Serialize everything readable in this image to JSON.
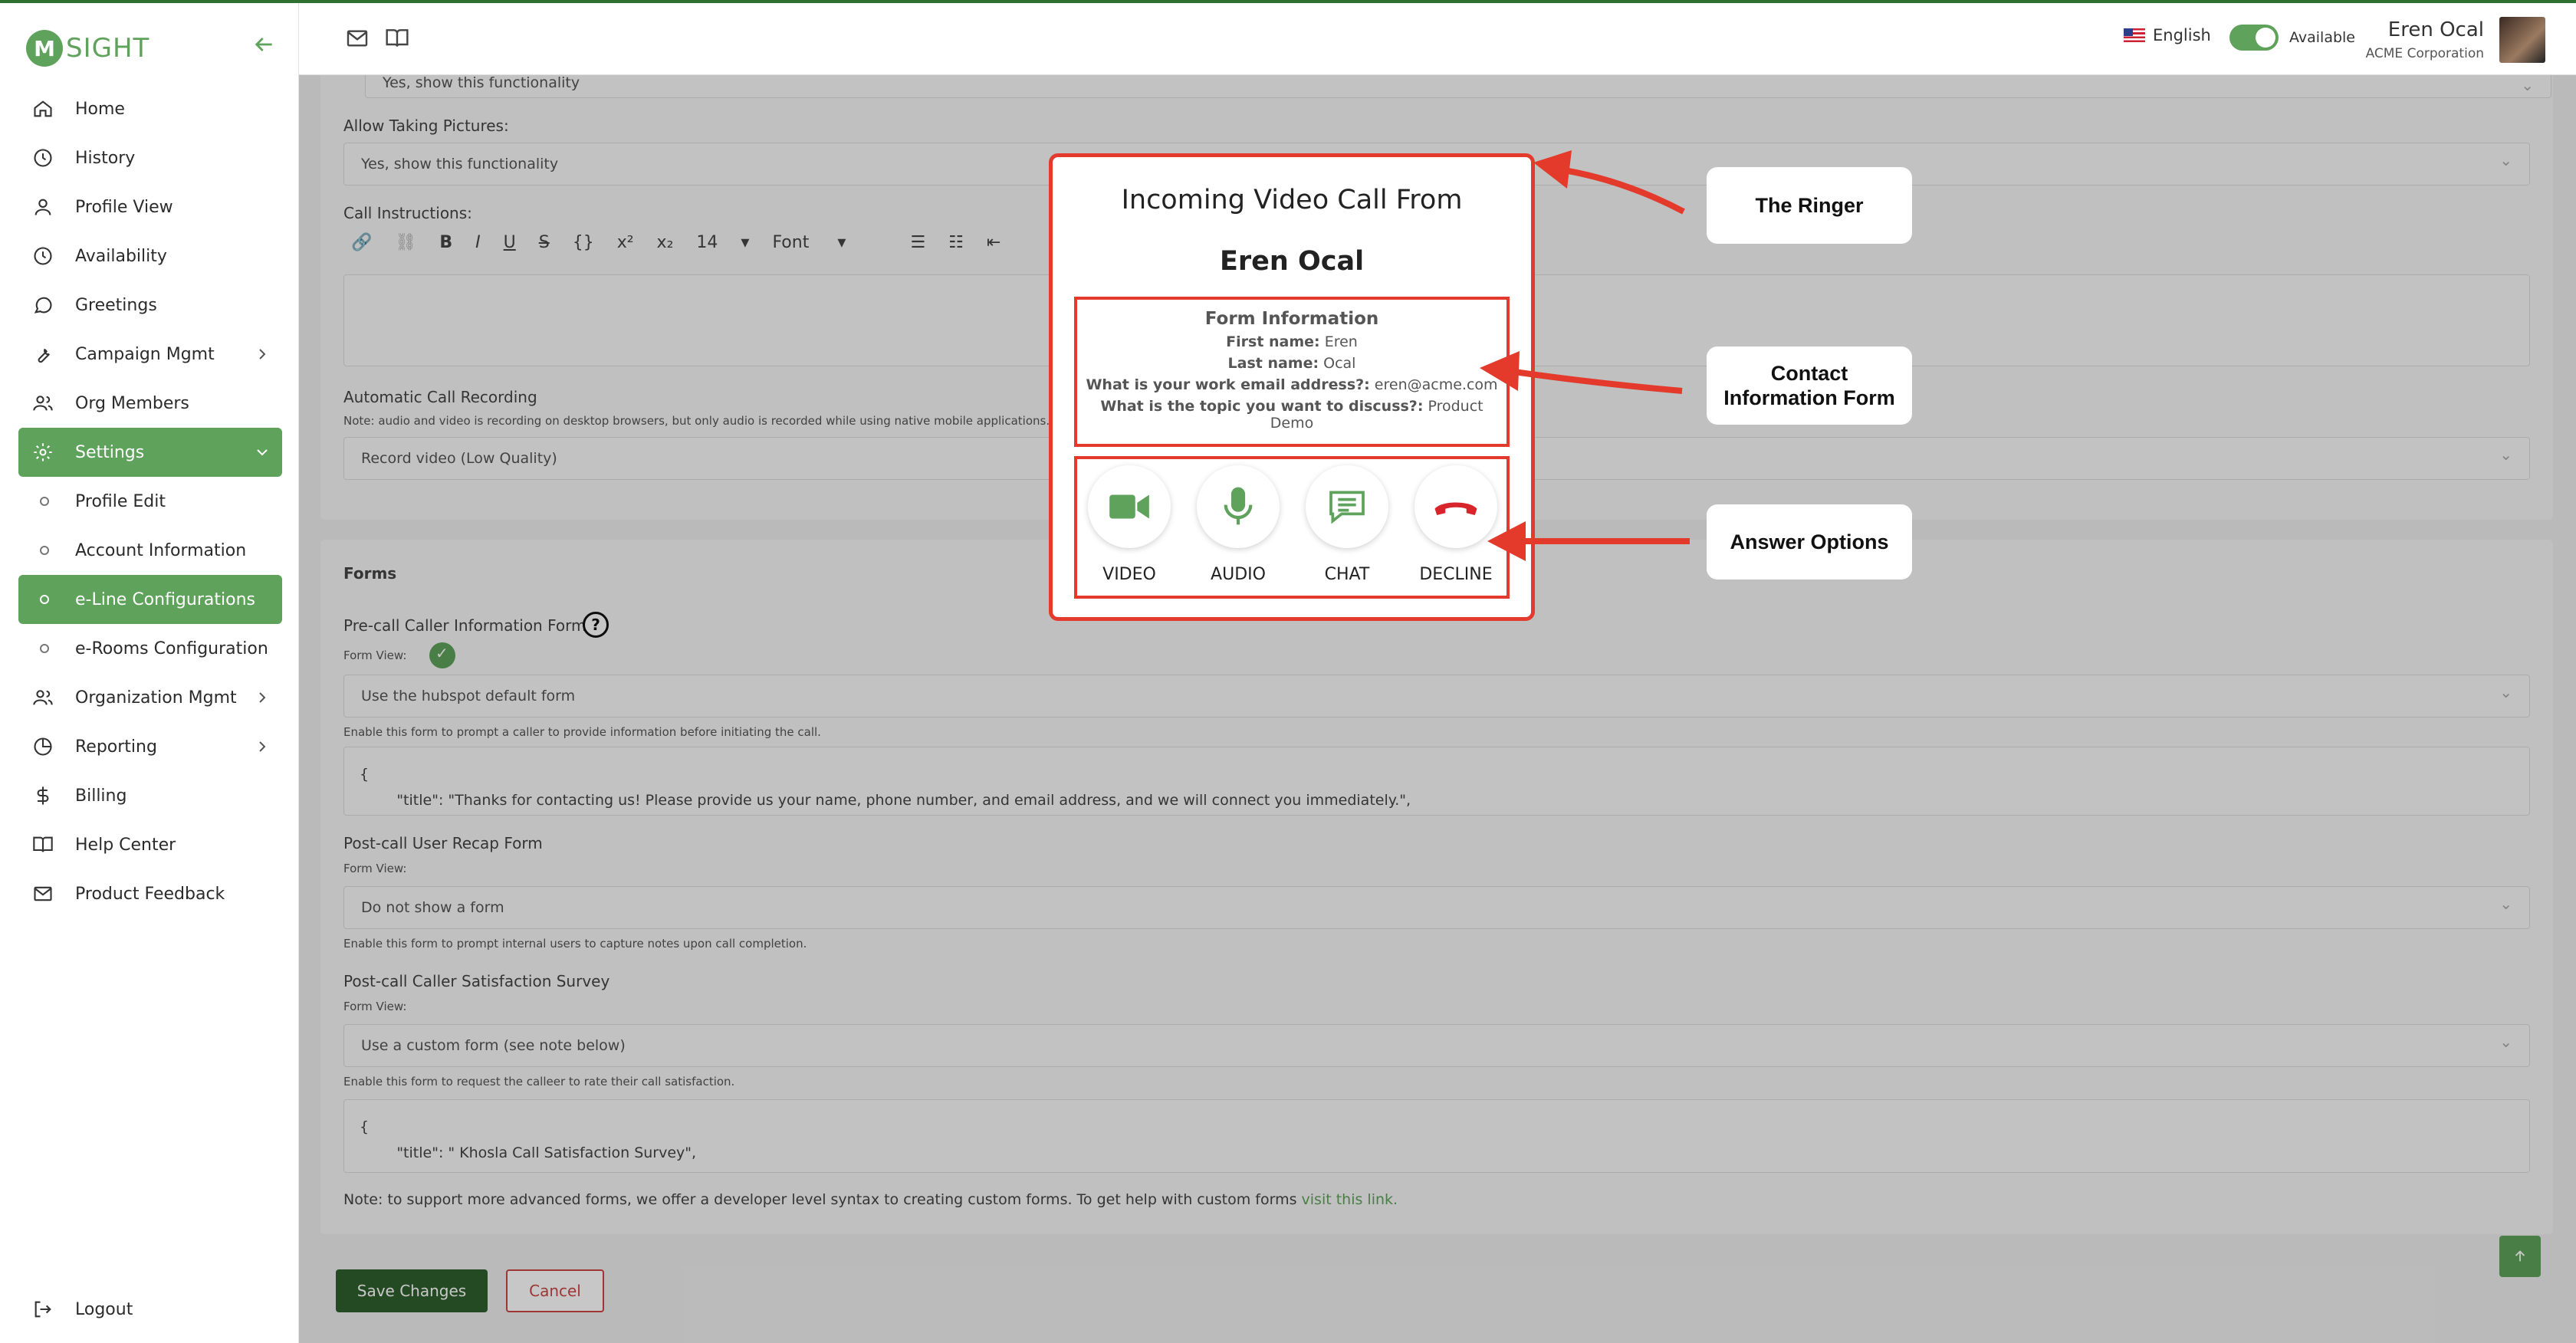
{
  "app": {
    "logo_mark": "M",
    "logo_text": "SIGHT"
  },
  "sidebar": {
    "items": [
      {
        "label": "Home",
        "icon": "home-icon"
      },
      {
        "label": "History",
        "icon": "clock-icon"
      },
      {
        "label": "Profile View",
        "icon": "user-icon"
      },
      {
        "label": "Availability",
        "icon": "clock-icon"
      },
      {
        "label": "Greetings",
        "icon": "chat-bubble-icon"
      },
      {
        "label": "Campaign Mgmt",
        "icon": "wrench-icon"
      },
      {
        "label": "Org Members",
        "icon": "users-icon"
      },
      {
        "label": "Settings",
        "icon": "gear-icon"
      },
      {
        "label": "Profile Edit"
      },
      {
        "label": "Account Information"
      },
      {
        "label": "e-Line Configurations"
      },
      {
        "label": "e-Rooms Configuration"
      },
      {
        "label": "Organization Mgmt",
        "icon": "users-icon"
      },
      {
        "label": "Reporting",
        "icon": "pie-chart-icon"
      },
      {
        "label": "Billing",
        "icon": "dollar-icon"
      },
      {
        "label": "Help Center",
        "icon": "book-icon"
      },
      {
        "label": "Product Feedback",
        "icon": "mail-icon"
      }
    ],
    "logout": "Logout"
  },
  "topbar": {
    "language": "English",
    "status": "Available",
    "user_name": "Eren Ocal",
    "user_org": "ACME Corporation"
  },
  "settings": {
    "top_select_value": "Yes, show this functionality",
    "pictures_label": "Allow Taking Pictures:",
    "pictures_value": "Yes, show this functionality",
    "instructions_label": "Call Instructions:",
    "toolbar": {
      "font_size": "14",
      "font": "Font"
    },
    "recording_label": "Automatic Call Recording",
    "recording_note": "Note: audio and video is recording on desktop browsers, but only audio is recorded while using native mobile applications.",
    "recording_value": "Record video (Low Quality)"
  },
  "forms": {
    "heading": "Forms",
    "precall_label": "Pre-call Caller Information Form",
    "form_view_label": "Form View:",
    "precall_value": "Use the hubspot default form",
    "precall_note": "Enable this form to prompt a caller to provide information before initiating the call.",
    "precall_json": "{\n        \"title\": \"Thanks for contacting us! Please provide us your name, phone number, and email address, and we will connect you immediately.\",\n        \"description\": \"\"",
    "postcall_label": "Post-call User Recap Form",
    "postcall_value": "Do not show a form",
    "postcall_note": "Enable this form to prompt internal users to capture notes upon call completion.",
    "survey_label": "Post-call Caller Satisfaction Survey",
    "survey_value": "Use a custom form (see note below)",
    "survey_note": "Enable this form to request the calleer to rate their call satisfaction.",
    "survey_json": "{\n        \"title\": \" Khosla Call Satisfaction Survey\",\n        \"description\": \"\"",
    "bottom_note": "Note: to support more advanced forms, we offer a developer level syntax to creating custom forms. To get help with custom forms ",
    "bottom_link": "visit this link.",
    "save": "Save Changes",
    "cancel": "Cancel"
  },
  "ringer": {
    "title": "Incoming Video Call From",
    "caller": "Eren Ocal",
    "form_title": "Form Information",
    "fields": [
      {
        "label": "First name:",
        "value": "Eren"
      },
      {
        "label": "Last name:",
        "value": "Ocal"
      },
      {
        "label": "What is your work email address?:",
        "value": "eren@acme.com"
      },
      {
        "label": "What is the topic you want to discuss?:",
        "value": "Product Demo"
      }
    ],
    "answers": [
      {
        "label": "VIDEO",
        "icon": "video-camera-icon"
      },
      {
        "label": "AUDIO",
        "icon": "microphone-icon"
      },
      {
        "label": "CHAT",
        "icon": "chat-icon"
      },
      {
        "label": "DECLINE",
        "icon": "hang-up-icon"
      }
    ]
  },
  "callouts": {
    "ringer": "The Ringer",
    "contact_line1": "Contact",
    "contact_line2": "Information Form",
    "answer": "Answer Options"
  },
  "colors": {
    "brand_green": "#5fa25b",
    "annotation_red": "#e33a2c",
    "save_green": "#2f5f2f"
  }
}
